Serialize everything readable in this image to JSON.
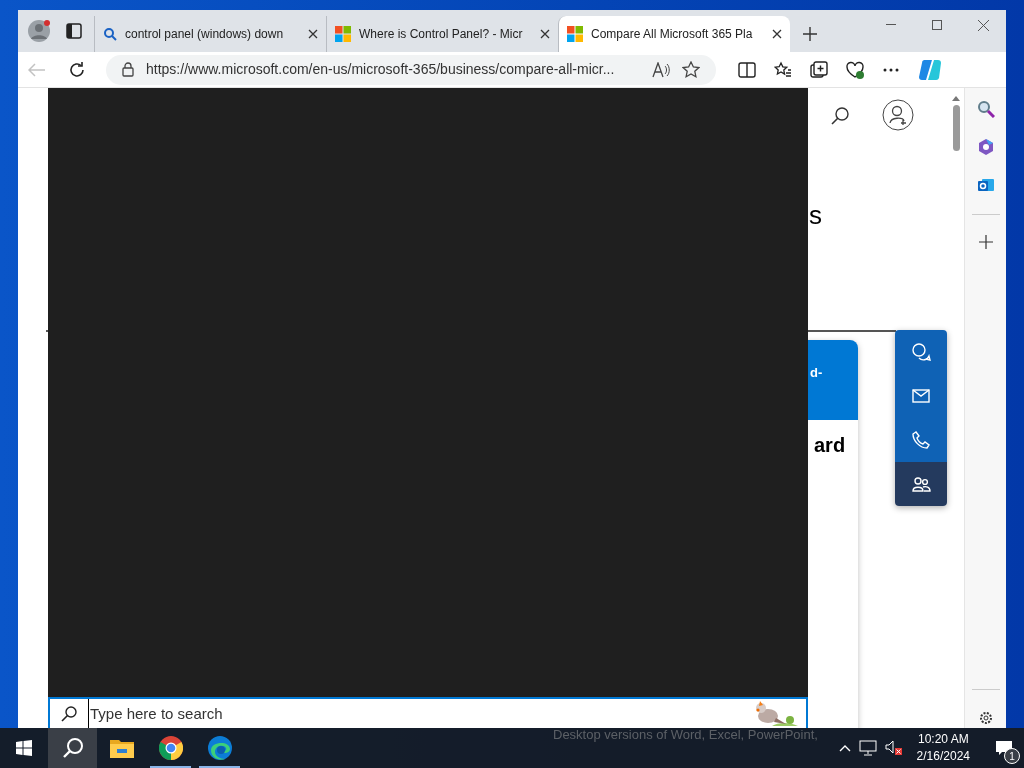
{
  "browser": {
    "tabs": [
      {
        "title": "control panel (windows) down",
        "kind": "search",
        "selected": false
      },
      {
        "title": "Where is Control Panel? - Micr",
        "kind": "microsoft",
        "selected": false
      },
      {
        "title": "Compare All Microsoft 365 Pla",
        "kind": "microsoft",
        "selected": true
      }
    ],
    "address": "https://www.microsoft.com/en-us/microsoft-365/business/compare-all-micr..."
  },
  "page": {
    "heading_fragment": "s",
    "card_fragment": "d-",
    "card_title_fragment": "ard",
    "behind_taskbar_text": "Desktop versions of Word, Excel, PowerPoint,"
  },
  "search_box": {
    "placeholder": "Type here to search"
  },
  "taskbar": {
    "apps": [
      {
        "kind": "search",
        "selected": true
      },
      {
        "kind": "explorer",
        "selected": false
      },
      {
        "kind": "chrome",
        "selected": false
      },
      {
        "kind": "edge",
        "selected": false
      }
    ],
    "time": "10:20 AM",
    "date": "2/16/2024",
    "notifications": "1"
  }
}
